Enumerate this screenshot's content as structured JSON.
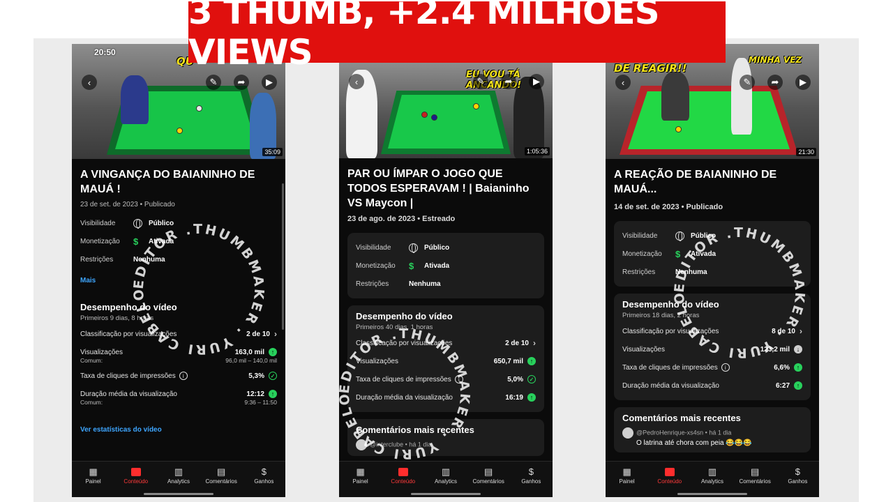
{
  "banner": "3 THUMB, +2.4 MILHÕES VIEWS",
  "phones": [
    {
      "status_time": "20:50",
      "thumb_overlay": "QU",
      "duration": "35:09",
      "title": "A VINGANÇA DO BAIANINHO DE MAUÁ !",
      "date": "23 de set. de 2023 • Publicado",
      "visibility_label": "Visibilidade",
      "visibility_value": "Público",
      "monetization_label": "Monetização",
      "monetization_value": "Ativada",
      "restrictions_label": "Restrições",
      "restrictions_value": "Nenhuma",
      "more": "Mais",
      "perf_title": "Desempenho do vídeo",
      "perf_sub": "Primeiros 9 dias, 8 horas",
      "rank_label": "Classificação por visualizações",
      "rank_value": "2 de 10",
      "views_label": "Visualizações",
      "views_value": "163,0 mil",
      "views_common_label": "Comum:",
      "views_common_value": "96,0 mil – 140,0 mil",
      "ctr_label": "Taxa de cliques de impressões",
      "ctr_value": "5,3%",
      "avd_label": "Duração média da visualização",
      "avd_value": "12:12",
      "avd_common_label": "Comum:",
      "avd_common_value": "9:36 – 11:50",
      "stats_link": "Ver estatísticas do vídeo"
    },
    {
      "thumb_overlay": "EU VOU TÁ ANCANDO!",
      "duration": "1:05:36",
      "title": "PAR OU ÍMPAR O JOGO QUE TODOS ESPERAVAM ! | Baianinho VS Maycon |",
      "date": "23 de ago. de 2023 • Estreado",
      "visibility_label": "Visibilidade",
      "visibility_value": "Público",
      "monetization_label": "Monetização",
      "monetization_value": "Ativada",
      "restrictions_label": "Restrições",
      "restrictions_value": "Nenhuma",
      "perf_title": "Desempenho do vídeo",
      "perf_sub": "Primeiros 40 dias, 1 horas",
      "rank_label": "Classificação por visualizações",
      "rank_value": "2 de 10",
      "views_label": "Visualizações",
      "views_value": "650,7 mil",
      "ctr_label": "Taxa de cliques de impressões",
      "ctr_value": "5,0%",
      "avd_label": "Duração média da visualização",
      "avd_value": "16:19",
      "comments_title": "Comentários mais recentes",
      "comment_user": "@interclube • há 1 dia"
    },
    {
      "thumb_overlay": "DE REAGIR!!",
      "thumb_overlay2": "MINHA VEZ",
      "duration": "21:30",
      "title": "A REAÇÃO DE BAIANINHO DE MAUÁ...",
      "date": "14 de set. de 2023 • Publicado",
      "visibility_label": "Visibilidade",
      "visibility_value": "Público",
      "monetization_label": "Monetização",
      "monetization_value": "Ativada",
      "restrictions_label": "Restrições",
      "restrictions_value": "Nenhuma",
      "perf_title": "Desempenho do vídeo",
      "perf_sub": "Primeiros 18 dias, 2 horas",
      "rank_label": "Classificação por visualizações",
      "rank_value": "8 de 10",
      "views_label": "Visualizações",
      "views_value": "123,2 mil",
      "ctr_label": "Taxa de cliques de impressões",
      "ctr_value": "6,6%",
      "avd_label": "Duração média da visualização",
      "avd_value": "6:27",
      "comments_title": "Comentários mais recentes",
      "comment_user": "@PedroHenrique-xs4sn • há 1 dia",
      "comment_text": "O latrina até chora com peia 😂😂😂"
    }
  ],
  "tabs": [
    "Painel",
    "Conteúdo",
    "Analytics",
    "Comentários",
    "Ganhos"
  ],
  "watermark": "EDITOR .THUMBMAKER . YURI CABELO"
}
